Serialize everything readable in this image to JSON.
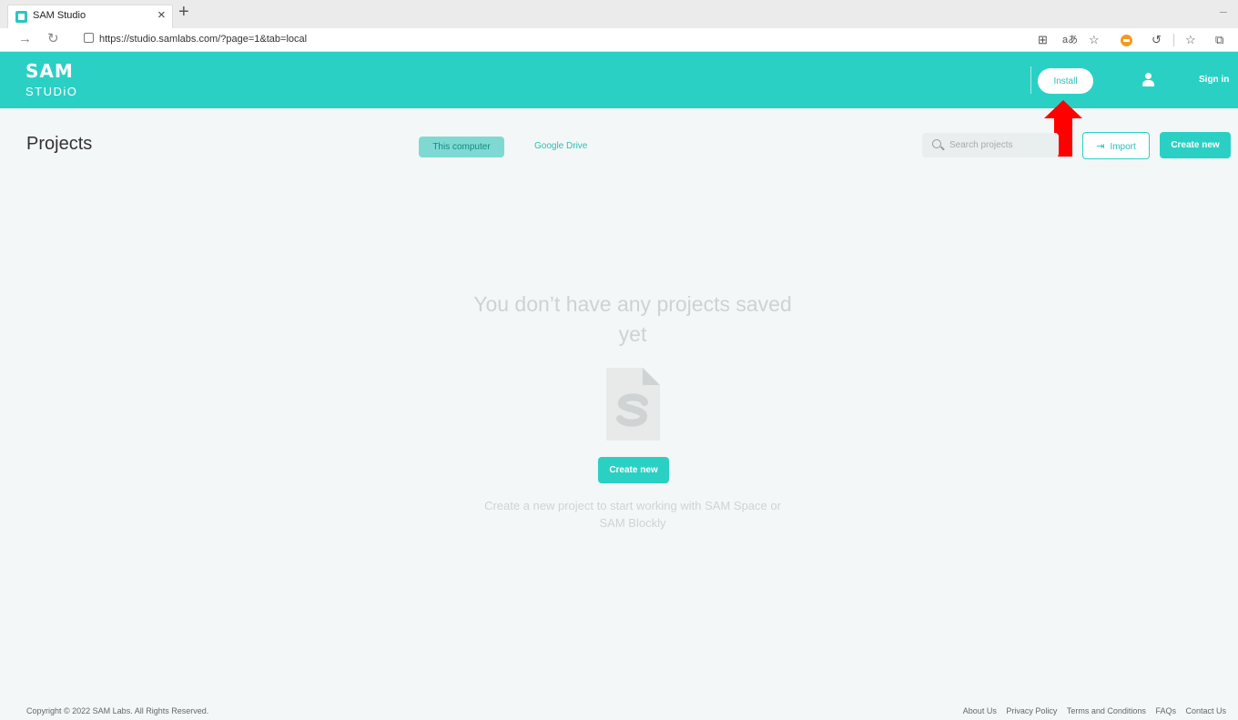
{
  "browser": {
    "tab_title": "SAM Studio",
    "tab_close": "×",
    "new_tab": "+",
    "url": "https://studio.samlabs.com/?page=1&tab=local"
  },
  "header": {
    "logo_top": "SAM",
    "logo_bottom": "STUDiO",
    "install_label": "Install",
    "signin_label": "Sign in"
  },
  "toolbar": {
    "title": "Projects",
    "tabs": [
      {
        "label": "This computer",
        "active": true
      },
      {
        "label": "Google Drive",
        "active": false
      }
    ],
    "search_placeholder": "Search projects",
    "import_label": "Import",
    "create_label": "Create new"
  },
  "empty_state": {
    "title": "You don’t have any projects saved yet",
    "create_label": "Create new",
    "subtitle": "Create a new project to start working with SAM Space or SAM Blockly"
  },
  "footer": {
    "copyright": "Copyright © 2022 SAM Labs. All Rights Reserved.",
    "links": [
      "About Us",
      "Privacy Policy",
      "Terms and Conditions",
      "FAQs",
      "Contact Us"
    ]
  },
  "colors": {
    "brand": "#2bd0c4",
    "annotation_arrow": "#ff0000"
  }
}
